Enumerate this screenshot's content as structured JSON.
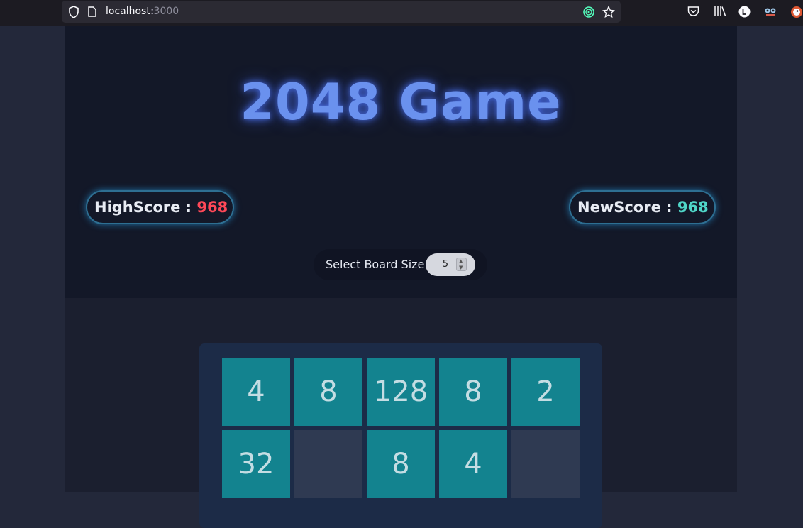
{
  "browser": {
    "url_host": "localhost",
    "url_port": ":3000"
  },
  "game": {
    "title": "2048 Game",
    "high_score_label": "HighScore : ",
    "high_score_value": "968",
    "new_score_label": "NewScore : ",
    "new_score_value": "968",
    "board_size_label": "Select Board Size",
    "board_size_value": "5",
    "tiles_row1": [
      "4",
      "8",
      "128",
      "8",
      "2"
    ],
    "tiles_row2": [
      "32",
      "",
      "8",
      "4",
      ""
    ]
  },
  "colors": {
    "title": "#6a91ee",
    "high_score": "#ff4858",
    "new_score": "#4fd6c8",
    "tile": "#13838f",
    "empty_tile": "#2f3a52"
  },
  "icons": [
    "shield-icon",
    "page-icon",
    "tracking-icon",
    "bookmark-star-icon",
    "pocket-icon",
    "library-icon",
    "account-icon",
    "extension-icon",
    "duckduckgo-icon"
  ]
}
